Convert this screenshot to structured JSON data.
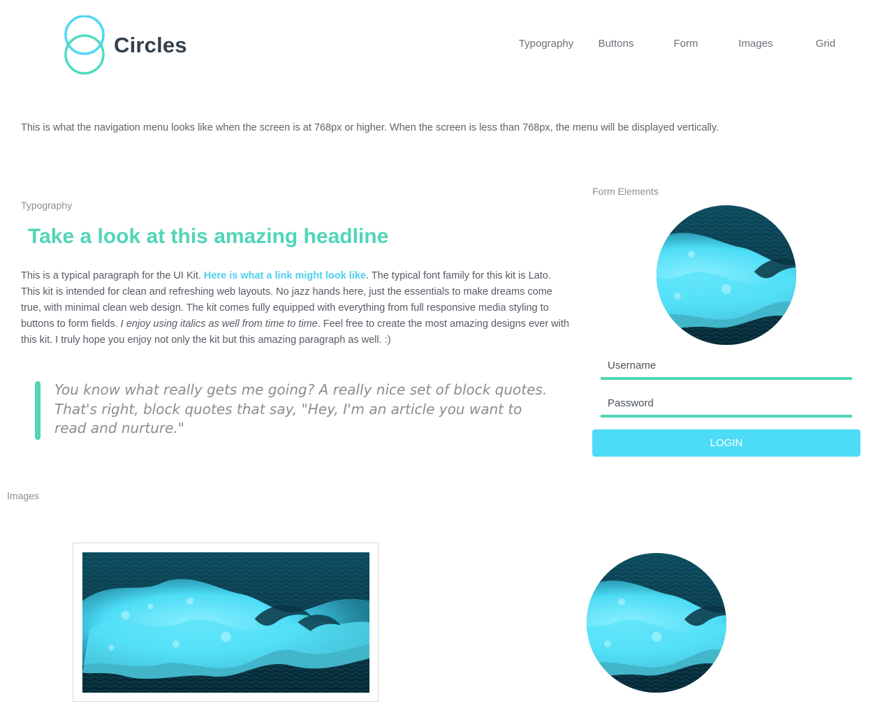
{
  "brand": {
    "name": "Circles",
    "colors": {
      "accent_teal": "#4fd6b7",
      "accent_cyan": "#4ddcf6",
      "ring_top": "#4dd7f2",
      "ring_bottom": "#4fdcbf"
    },
    "icon": "two-circles-logo-icon"
  },
  "nav": {
    "items": [
      {
        "label": "Typography"
      },
      {
        "label": "Buttons"
      },
      {
        "label": "Form"
      },
      {
        "label": "Images"
      },
      {
        "label": "Grid"
      }
    ],
    "note": "This is what the navigation menu looks like when the screen is at 768px or higher. When the screen is less than 768px, the menu will be displayed vertically."
  },
  "typography": {
    "section_label": "Typography",
    "headline": "Take a look at this amazing headline",
    "paragraph": {
      "intro": "This is a typical paragraph for the UI Kit. ",
      "link": "Here is what a link might look like",
      "middle": ". The typical font family for this kit is Lato. This kit is intended for clean and refreshing web layouts. No jazz hands here, just the essentials to make dreams come true, with minimal clean web design. The kit comes fully equipped with everything from full responsive media styling to buttons to form fields. ",
      "italic": "I enjoy using italics as well from time to time",
      "end": ". Feel free to create the most amazing designs ever with this kit. I truly hope you enjoy not only the kit but this amazing paragraph as well. :)"
    },
    "blockquote": "You know what really gets me going? A really nice set of block quotes. That's right, block quotes that say, \"Hey, I'm an article you want to read and nurture.\""
  },
  "form": {
    "section_label": "Form Elements",
    "image_icon": "ocean-wave-image",
    "username_placeholder": "Username",
    "password_placeholder": "Password",
    "login_label": "LOGIN"
  },
  "images": {
    "section_label": "Images",
    "framed_image_icon": "ocean-wave-image",
    "circle_image_icon": "ocean-wave-image"
  }
}
